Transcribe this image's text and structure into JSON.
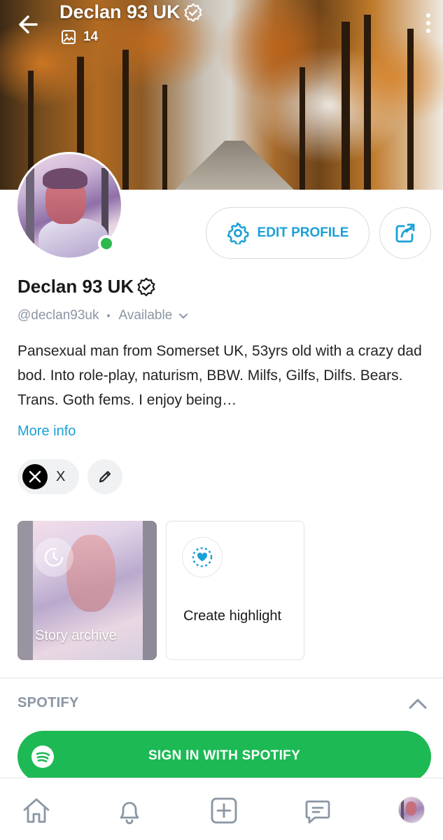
{
  "header": {
    "title": "Declan 93 UK",
    "media_count": "14",
    "back_icon": "arrow-left-icon",
    "more_icon": "more-vertical-icon"
  },
  "profile": {
    "name": "Declan 93 UK",
    "handle": "@declan93uk",
    "status": "Available",
    "verified_icon": "verified-badge-icon",
    "online_color": "#2db84b",
    "bio": "Pansexual man from Somerset UK, 53yrs old with a crazy dad bod. Into role-play, naturism, BBW. Milfs, Gilfs, Dilfs. Bears. Trans. Goth fems. I enjoy being…",
    "more_info": "More info"
  },
  "actions": {
    "edit_profile": "EDIT PROFILE",
    "edit_icon": "gear-icon",
    "share_icon": "share-icon"
  },
  "social_links": [
    {
      "label": "X",
      "icon": "x-logo-icon"
    }
  ],
  "highlights": {
    "story_archive": "Story archive",
    "create_highlight": "Create highlight"
  },
  "spotify": {
    "section_title": "SPOTIFY",
    "sign_in": "SIGN IN WITH SPOTIFY",
    "brand_color": "#1db954"
  },
  "bottom_nav": [
    "home-icon",
    "bell-icon",
    "plus-square-icon",
    "messages-icon",
    "profile-avatar"
  ],
  "colors": {
    "accent": "#1ba0d7",
    "muted": "#8a96a3"
  }
}
